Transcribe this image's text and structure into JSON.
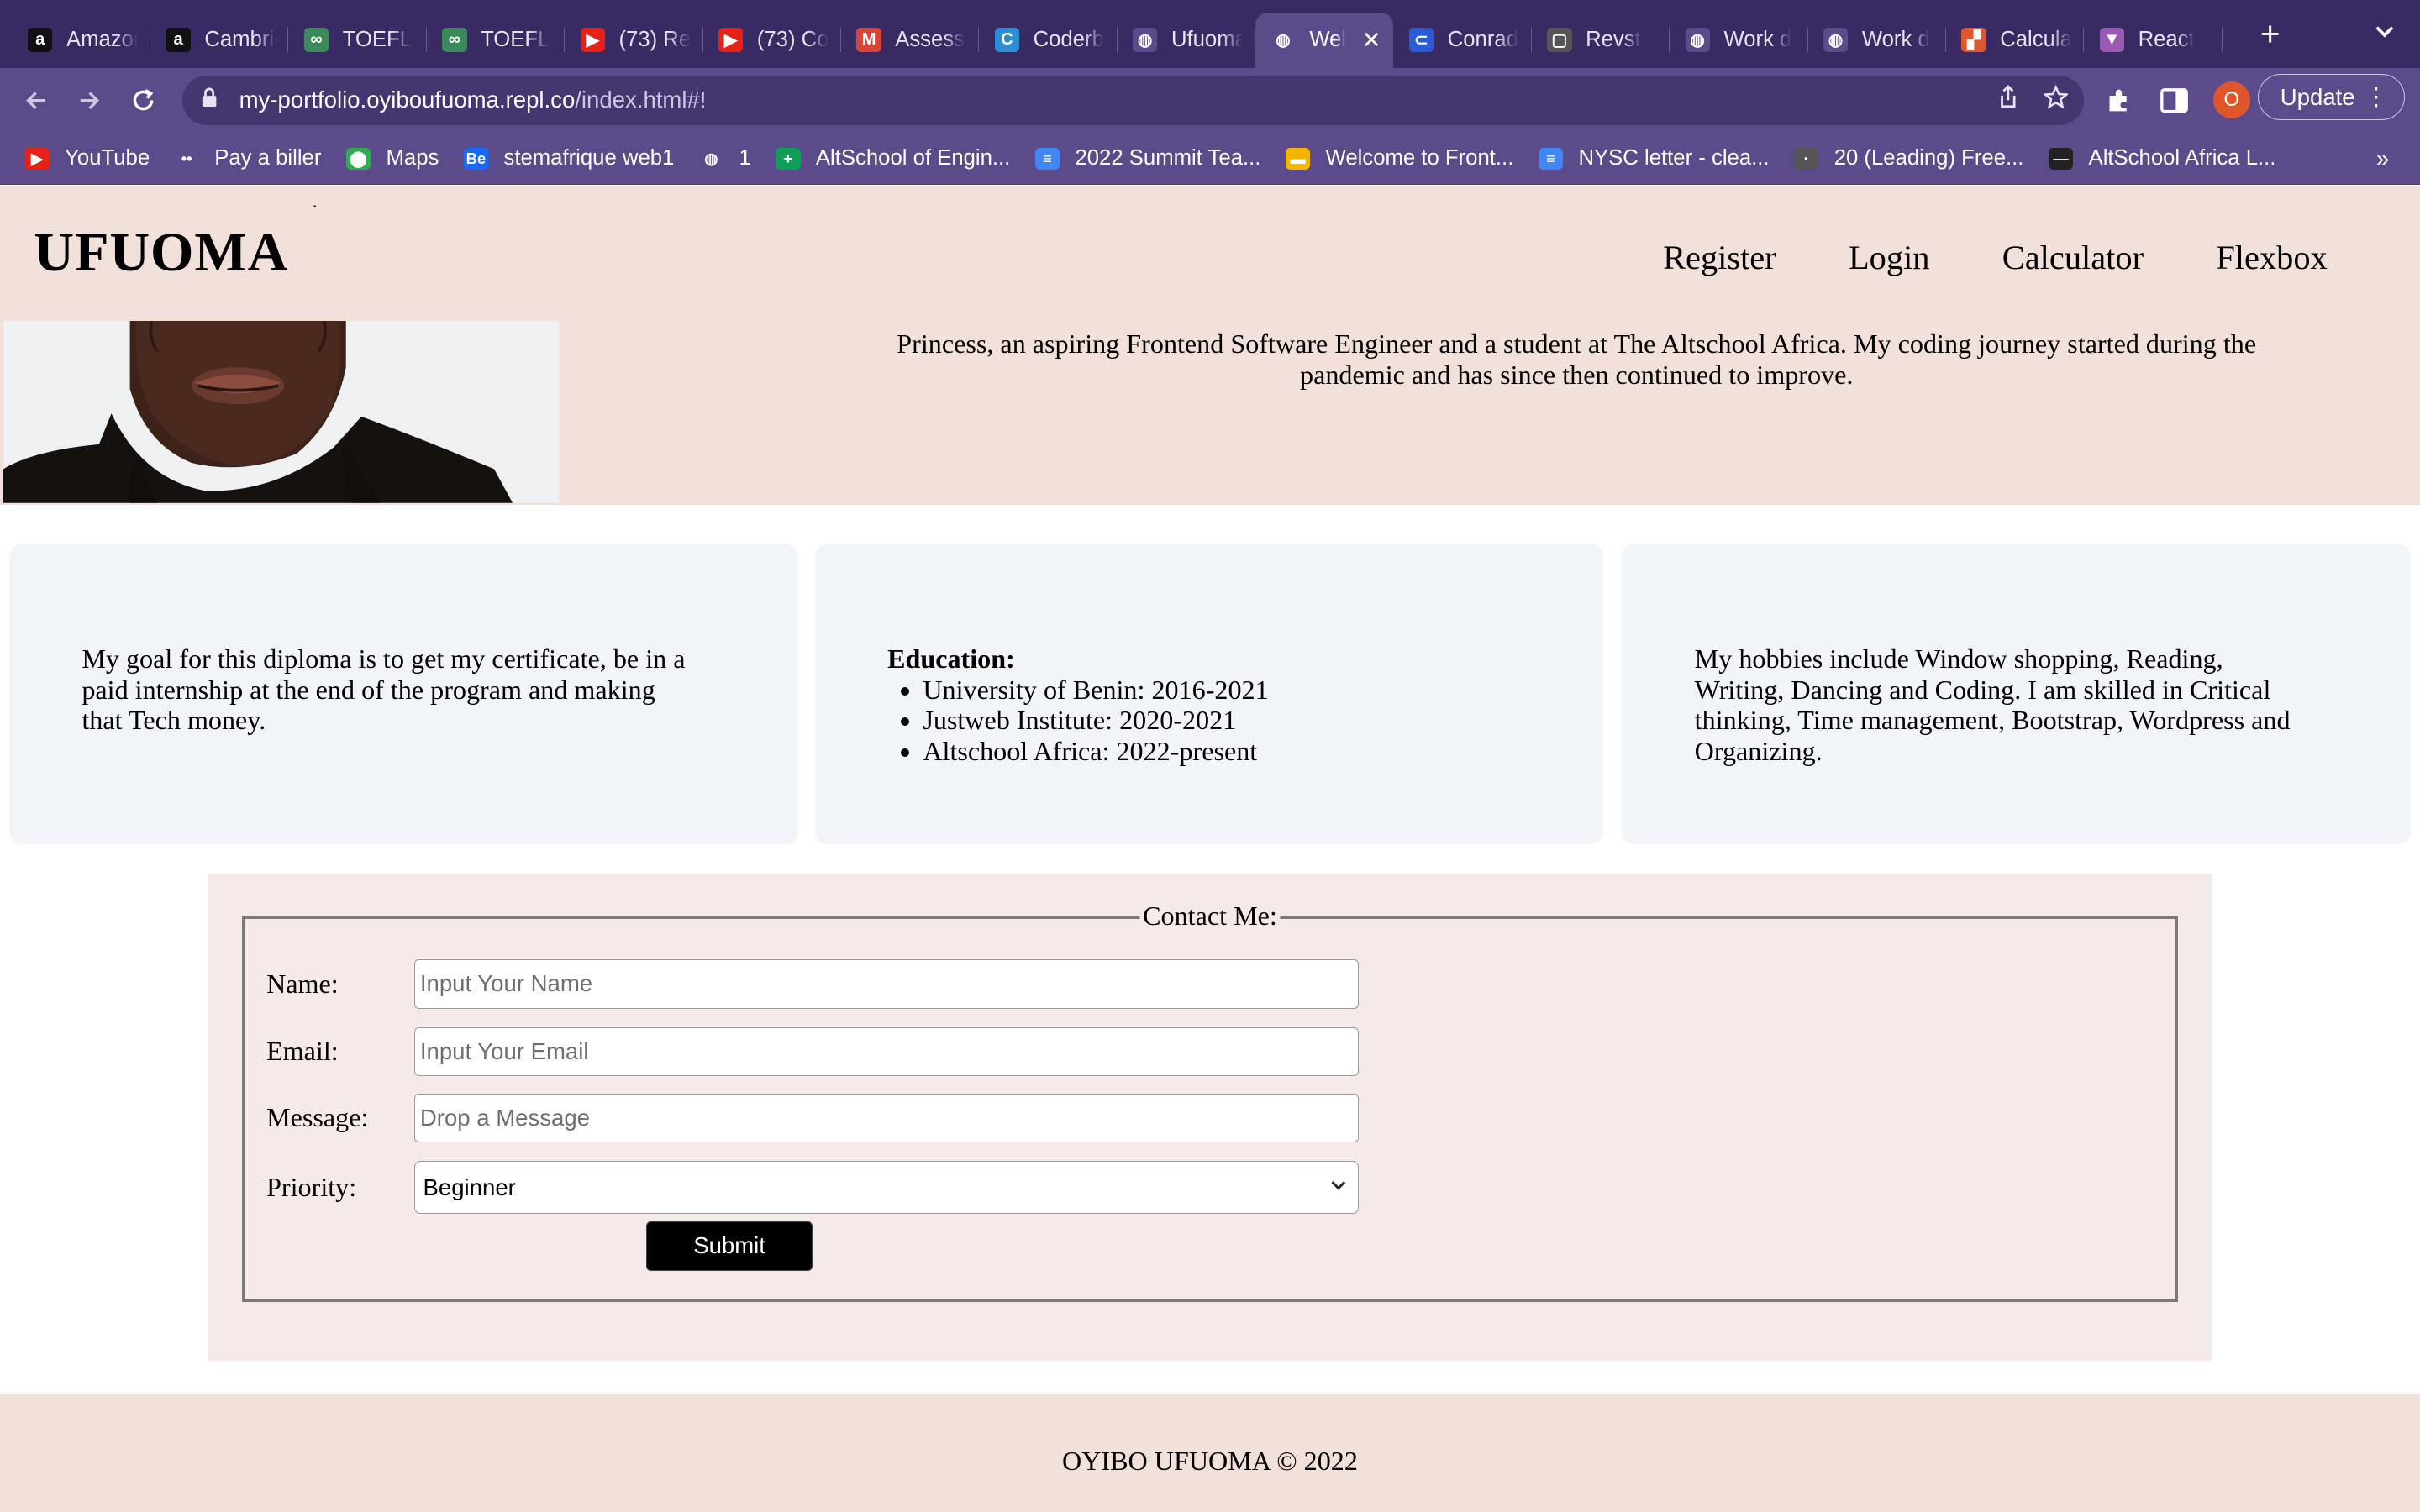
{
  "browser": {
    "tabs": [
      {
        "title": "Amazon",
        "fav": "a",
        "color": "#111111"
      },
      {
        "title": "Cambridge",
        "fav": "a",
        "color": "#111111"
      },
      {
        "title": "TOEFL",
        "fav": "∞",
        "color": "#3a8a5a"
      },
      {
        "title": "TOEFL",
        "fav": "∞",
        "color": "#3a8a5a"
      },
      {
        "title": "(73) Re",
        "fav": "▶",
        "color": "#e62117"
      },
      {
        "title": "(73) Co",
        "fav": "▶",
        "color": "#e62117"
      },
      {
        "title": "Assess",
        "fav": "M",
        "color": "#d44638"
      },
      {
        "title": "Coderb",
        "fav": "C",
        "color": "#2b8fd4"
      },
      {
        "title": "Ufuoma",
        "fav": "◍",
        "color": "#5b4b8a"
      },
      {
        "title": "Wel",
        "fav": "◍",
        "color": "#5b4b8a",
        "active": true
      },
      {
        "title": "Conrad",
        "fav": "⊂",
        "color": "#2a5bd7"
      },
      {
        "title": "Revst",
        "fav": "▢",
        "color": "#555555"
      },
      {
        "title": "Work d",
        "fav": "◍",
        "color": "#5b4b8a"
      },
      {
        "title": "Work d",
        "fav": "◍",
        "color": "#5b4b8a"
      },
      {
        "title": "Calcula",
        "fav": "▞",
        "color": "#e0562b"
      },
      {
        "title": "React",
        "fav": "▼",
        "color": "#9b59b6"
      }
    ],
    "url_host": "my-portfolio.oyiboufuoma.repl.co",
    "url_path": "/index.html#!",
    "profile_initial": "O",
    "update_label": "Update",
    "bookmarks": [
      {
        "label": "YouTube",
        "icon": "▶",
        "color": "#e62117"
      },
      {
        "label": "Pay a biller",
        "icon": "••",
        "color": "#5b4b8a"
      },
      {
        "label": "Maps",
        "icon": "⬤",
        "color": "#34a853"
      },
      {
        "label": "stemafrique web1",
        "icon": "Be",
        "color": "#1769ff"
      },
      {
        "label": "1",
        "icon": "◍",
        "color": "#5b4b8a"
      },
      {
        "label": "AltSchool of Engin...",
        "icon": "+",
        "color": "#0f9d58"
      },
      {
        "label": "2022 Summit Tea...",
        "icon": "≡",
        "color": "#4285f4"
      },
      {
        "label": "Welcome to Front...",
        "icon": "▬",
        "color": "#f4b400"
      },
      {
        "label": "NYSC letter - clea...",
        "icon": "≡",
        "color": "#4285f4"
      },
      {
        "label": "20 (Leading) Free...",
        "icon": "·",
        "color": "#555555"
      },
      {
        "label": "AltSchool Africa L...",
        "icon": "—",
        "color": "#222222"
      }
    ],
    "bookmarks_more": "»"
  },
  "site": {
    "logo": "UFUOMA",
    "nav": [
      "Register",
      "Login",
      "Calculator",
      "Flexbox"
    ],
    "bio_line2": "Princess, an aspiring Frontend Software Engineer and a student at The Altschool Africa. My coding journey started during the",
    "bio_line3": "pandemic and has since then continued to improve.",
    "card_goal": "My goal for this diploma is to get my certificate, be in a paid internship at the end of the program and making that Tech money.",
    "education_heading": "Education:",
    "education": [
      "University of Benin: 2016-2021",
      "Justweb Institute: 2020-2021",
      "Altschool Africa: 2022-present"
    ],
    "card_hobbies": "My hobbies include Window shopping, Reading, Writing, Dancing and Coding. I am skilled in Critical thinking, Time management, Bootstrap, Wordpress and Organizing.",
    "contact": {
      "legend": "Contact Me:",
      "name_label": "Name:",
      "name_placeholder": "Input Your Name",
      "email_label": "Email:",
      "email_placeholder": "Input Your Email",
      "message_label": "Message:",
      "message_placeholder": "Drop a Message",
      "priority_label": "Priority:",
      "priority_value": "Beginner",
      "submit": "Submit"
    },
    "footer": "OYIBO UFUOMA © 2022"
  }
}
